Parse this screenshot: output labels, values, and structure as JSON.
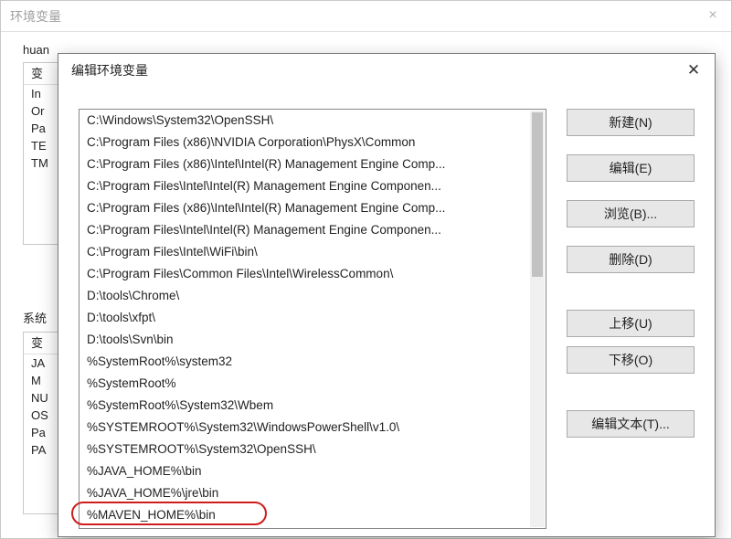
{
  "parent": {
    "title": "环境变量",
    "user_section_label": "huan",
    "system_section_label": "系统",
    "col_var": "变",
    "user_rows": [
      "In",
      "Or",
      "Pa",
      "TE",
      "TM"
    ],
    "sys_rows": [
      "JA",
      "M",
      "NU",
      "OS",
      "Pa",
      "PA"
    ]
  },
  "child": {
    "title": "编辑环境变量",
    "buttons": {
      "new": "新建(N)",
      "edit": "编辑(E)",
      "browse": "浏览(B)...",
      "delete": "删除(D)",
      "up": "上移(U)",
      "down": "下移(O)",
      "edit_text": "编辑文本(T)..."
    },
    "items": [
      "C:\\Windows\\System32\\OpenSSH\\",
      "C:\\Program Files (x86)\\NVIDIA Corporation\\PhysX\\Common",
      "C:\\Program Files (x86)\\Intel\\Intel(R) Management Engine Comp...",
      "C:\\Program Files\\Intel\\Intel(R) Management Engine Componen...",
      "C:\\Program Files (x86)\\Intel\\Intel(R) Management Engine Comp...",
      "C:\\Program Files\\Intel\\Intel(R) Management Engine Componen...",
      "C:\\Program Files\\Intel\\WiFi\\bin\\",
      "C:\\Program Files\\Common Files\\Intel\\WirelessCommon\\",
      "D:\\tools\\Chrome\\",
      "D:\\tools\\xfpt\\",
      "D:\\tools\\Svn\\bin",
      "%SystemRoot%\\system32",
      "%SystemRoot%",
      "%SystemRoot%\\System32\\Wbem",
      "%SYSTEMROOT%\\System32\\WindowsPowerShell\\v1.0\\",
      "%SYSTEMROOT%\\System32\\OpenSSH\\",
      "%JAVA_HOME%\\bin",
      "%JAVA_HOME%\\jre\\bin",
      "%MAVEN_HOME%\\bin"
    ],
    "highlight_index": 18
  }
}
